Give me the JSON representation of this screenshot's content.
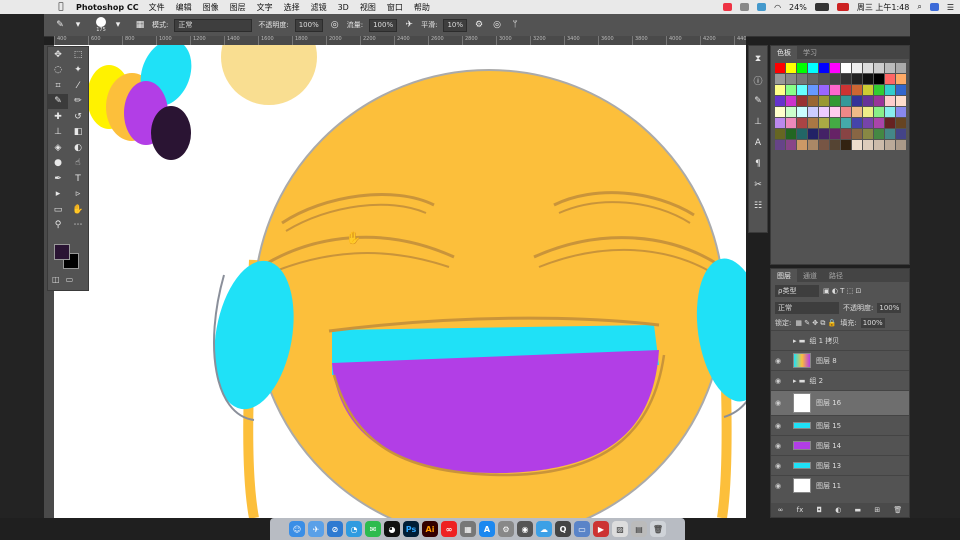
{
  "menubar": {
    "app": "Photoshop CC",
    "items": [
      "文件",
      "编辑",
      "图像",
      "图层",
      "文字",
      "选择",
      "滤镜",
      "3D",
      "视图",
      "窗口",
      "帮助"
    ],
    "battery": "24%",
    "clock": "周三 上午1:48"
  },
  "options": {
    "brush_size": "175",
    "mode_label": "模式:",
    "mode_value": "正常",
    "opacity_label": "不透明度:",
    "opacity_value": "100%",
    "flow_label": "流量:",
    "flow_value": "100%",
    "smooth_label": "平滑:",
    "smooth_value": "10%"
  },
  "ruler": [
    "400",
    "600",
    "800",
    "1000",
    "1200",
    "1400",
    "1600",
    "1800",
    "2000",
    "2200",
    "2400",
    "2600",
    "2800",
    "3000",
    "3200",
    "3400",
    "3600",
    "3800",
    "4000",
    "4200",
    "4400",
    "4600",
    "4800"
  ],
  "swatches_panel": {
    "tabs": [
      "色板",
      "学习"
    ]
  },
  "layers_panel": {
    "tabs": [
      "图层",
      "通道",
      "路径"
    ],
    "filter": "ρ类型",
    "blend_mode": "正常",
    "opacity_label": "不透明度:",
    "opacity_value": "100%",
    "lock_label": "锁定:",
    "fill_label": "填充:",
    "fill_value": "100%",
    "layers": [
      {
        "name": "组 1 拷贝",
        "type": "group"
      },
      {
        "name": "图层 8",
        "type": "layer"
      },
      {
        "name": "组 2",
        "type": "group"
      },
      {
        "name": "图层 16",
        "type": "layer",
        "selected": true
      },
      {
        "name": "图层 15",
        "type": "layer"
      },
      {
        "name": "图层 14",
        "type": "layer"
      },
      {
        "name": "图层 13",
        "type": "layer"
      },
      {
        "name": "图层 11",
        "type": "layer"
      }
    ]
  },
  "colors": {
    "face": "#fcbf3b",
    "cyan": "#1fe1f7",
    "purple": "#b23ee6",
    "foreground": "#2a1433",
    "sketch": "#c9943a"
  }
}
